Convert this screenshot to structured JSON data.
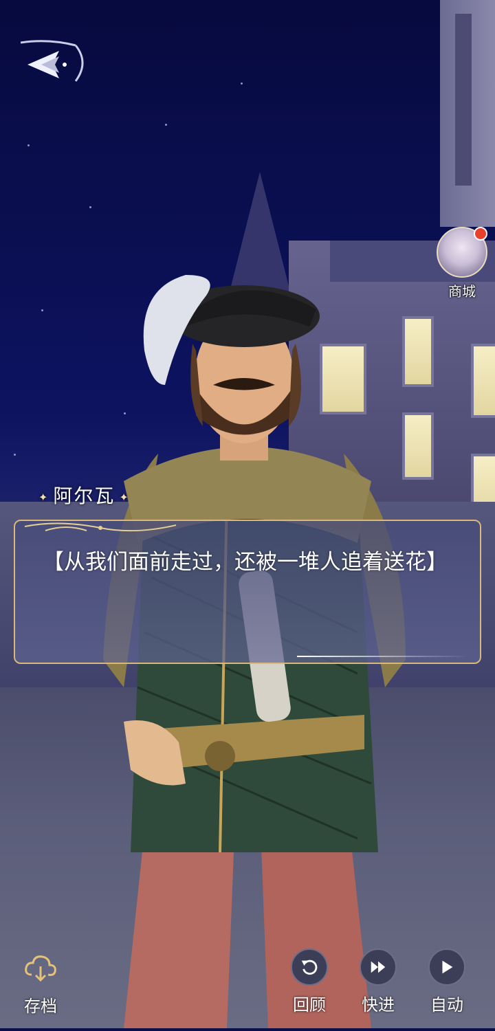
{
  "header": {
    "back_icon": "back-arrow-icon"
  },
  "shop": {
    "label": "商城",
    "has_notification": true
  },
  "dialogue": {
    "speaker": "阿尔瓦",
    "text": "【从我们面前走过，还被一堆人追着送花】"
  },
  "controls": {
    "save_label": "存档",
    "review_label": "回顾",
    "fast_forward_label": "快进",
    "auto_label": "自动"
  },
  "colors": {
    "dialog_border": "#d8b978",
    "notification": "#e8402d"
  }
}
